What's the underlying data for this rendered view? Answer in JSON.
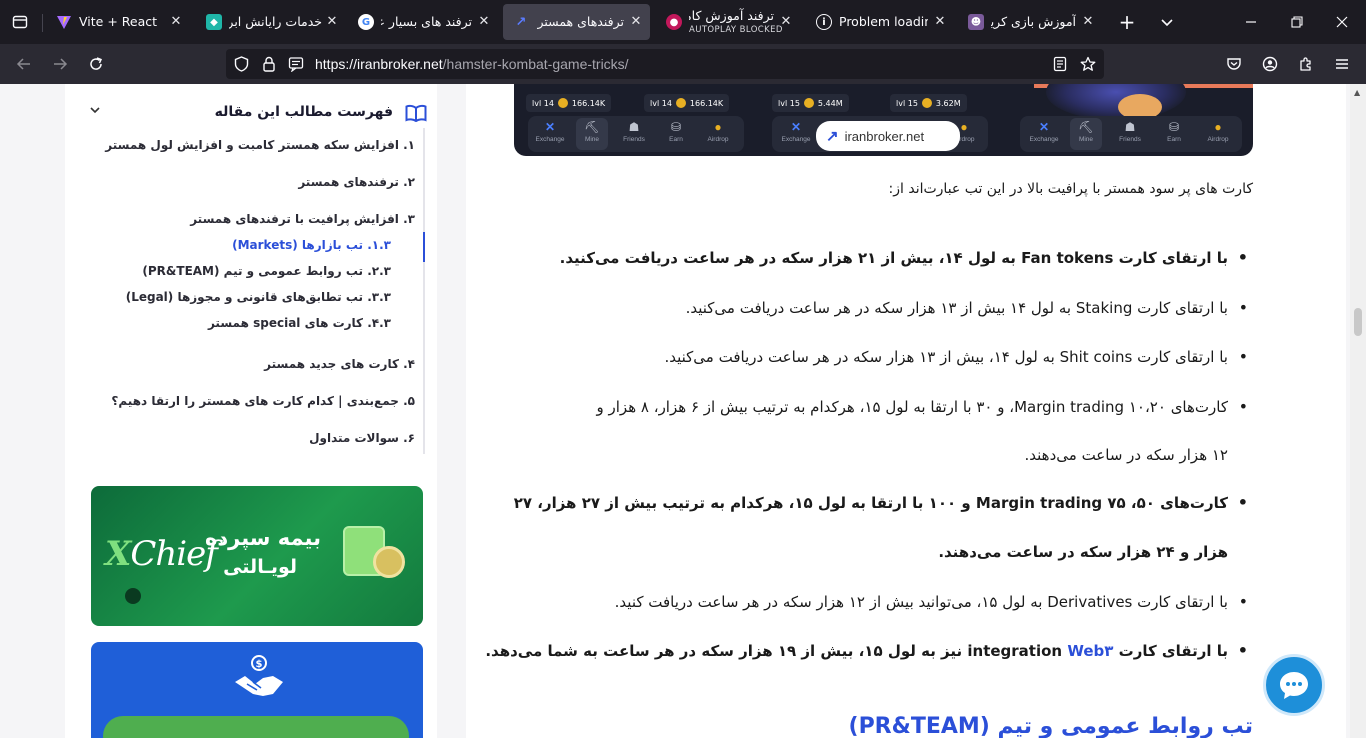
{
  "browser": {
    "tabs": [
      {
        "title": "Vite + React",
        "active": false
      },
      {
        "title": "خدمات رایانش ابری",
        "active": false
      },
      {
        "title": "ترفند های بسیار عالی",
        "active": false
      },
      {
        "title": "ترفندهای همستر کامبت",
        "active": true
      },
      {
        "title": "ترفند آموزش کامل",
        "subtitle": "AUTOPLAY BLOCKED",
        "active": false
      },
      {
        "title": "Problem loading page",
        "active": false
      },
      {
        "title": "آموزش بازی کریپتو",
        "active": false
      }
    ],
    "url": {
      "domain": "https://iranbroker.net",
      "path": "/hamster-kombat-game-tricks/"
    }
  },
  "toc": {
    "title": "فهرست مطالب این مقاله",
    "items": [
      {
        "label": "۱.  افزایش سکه همستر کامبت و افزایش لول همستر"
      },
      {
        "label": "۲.  ترفندهای همستر"
      },
      {
        "label": "۳.  افزایش پرافیت با ترفندهای همستر"
      },
      {
        "label": "۱.۳.  تب بازارها (Markets)",
        "active": true
      },
      {
        "label": "۲.۳.  تب روابط عمومی و تیم (PR&TEAM)"
      },
      {
        "label": "۳.۳.  تب تطابق‌های قانونی و مجوزها (Legal)"
      },
      {
        "label": "۴.۳.  کارت های special همستر"
      },
      {
        "label": "۴.  کارت های جدید همستر"
      },
      {
        "label": "۵.  جمع‌بندی | کدام کارت های همستر را ارتقا دهیم؟"
      },
      {
        "label": "۶.  سوالات متداول"
      }
    ]
  },
  "ads": {
    "ad1": {
      "brand": "Chief",
      "brand_prefix": "X",
      "line1": "بیمه سپرده",
      "line2": "لویـالتی"
    }
  },
  "banner": {
    "stats": [
      {
        "level": "lvl 14",
        "value": "166.14K"
      },
      {
        "level": "lvl 14",
        "value": "166.14K"
      },
      {
        "level": "lvl 15",
        "value": "5.44M"
      },
      {
        "level": "lvl 15",
        "value": "3.62M"
      }
    ],
    "nav_labels": [
      "Exchange",
      "Mine",
      "Friends",
      "Earn",
      "Airdrop"
    ],
    "brand": "iranbroker.net"
  },
  "article": {
    "intro": "کارت های پر سود همستر با پرافیت بالا در این تب عبارت‌اند از:",
    "bullets": [
      {
        "text": "با ارتقای کارت Fan tokens به لول ۱۴، بیش از ۲۱ هزار سکه در هر ساعت دریافت می‌کنید.",
        "bold": true
      },
      {
        "text": "با ارتقای کارت Staking به لول ۱۴ بیش از ۱۳ هزار سکه در هر ساعت دریافت می‌کنید.",
        "bold": false
      },
      {
        "text": "با ارتقای کارت Shit coins به لول ۱۴، بیش از ۱۳ هزار سکه در هر ساعت دریافت می‌کنید.",
        "bold": false
      },
      {
        "text": "کارت‌های ۱۰،۲۰ Margin trading، و ۳۰ با ارتقا به لول ۱۵، هرکدام به ترتیب بیش از ۶ هزار، ۸ هزار و",
        "bold": false
      },
      {
        "text": "۱۲ هزار سکه در ساعت می‌دهند.",
        "bold": false,
        "continuation": true
      },
      {
        "text": "کارت‌های ۵۰، ۷۵ Margin trading و ۱۰۰ با ارتقا به لول ۱۵، هرکدام به ترتیب بیش از ۲۷ هزار، ۲۷",
        "bold": true
      },
      {
        "text": "هزار و ۲۴ هزار سکه در ساعت می‌دهند.",
        "bold": true,
        "continuation": true
      },
      {
        "text": "با ارتقای کارت Derivatives به لول ۱۵، می‌توانید بیش از ۱۲ هزار سکه در هر ساعت دریافت کنید.",
        "bold": false
      }
    ],
    "last_bullet": {
      "before": "با ارتقای کارت integration ",
      "link": "Web۳",
      "after": " نیز به لول ۱۵، بیش از ۱۹ هزار سکه در هر ساعت به شما می‌دهد."
    },
    "next_heading": "تب روابط عمومی و تیم (PR&TEAM)"
  }
}
